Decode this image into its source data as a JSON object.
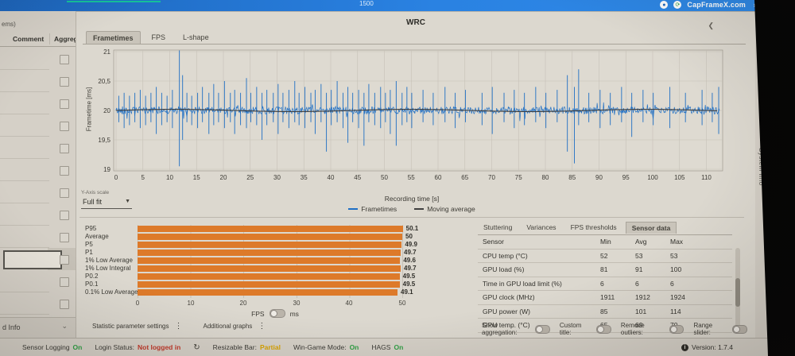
{
  "colors": {
    "accent_blue": "#2a7fe0",
    "bar_orange": "#dd7a2a",
    "line_blue": "#1f6fc4",
    "avg_dark": "#3f3f3f",
    "green": "#2f9e44",
    "red": "#c0392b",
    "amber": "#d7a200"
  },
  "topbar": {
    "brand": "CapFrameX.com",
    "center_text": "1500"
  },
  "sidebar": {
    "top_cut_text": "ems)",
    "columns": [
      "Comment",
      "Aggreg"
    ],
    "row_count": 12,
    "input_row_index": 9,
    "comment_input_value": "",
    "footer_label": "d Info"
  },
  "main": {
    "title": "WRC",
    "tabs": [
      {
        "label": "Frametimes",
        "active": true
      },
      {
        "label": "FPS",
        "active": false
      },
      {
        "label": "L-shape",
        "active": false
      }
    ],
    "yaxis_scale_label": "Y-Axis scale",
    "yaxis_scale_value": "Full fit",
    "fps_toggle": {
      "left": "FPS",
      "right": "ms"
    },
    "side_tab": "System Info"
  },
  "chart_data": [
    {
      "type": "line",
      "title": "WRC",
      "xlabel": "Recording time [s]",
      "ylabel": "Frametime [ms]",
      "xlim": [
        0,
        113
      ],
      "ylim": [
        19,
        21
      ],
      "xticks": [
        0,
        5,
        10,
        15,
        20,
        25,
        30,
        35,
        40,
        45,
        50,
        55,
        60,
        65,
        70,
        75,
        80,
        85,
        90,
        95,
        100,
        105,
        110
      ],
      "yticks": [
        19,
        19.5,
        20,
        20.5,
        21
      ],
      "ytick_labels": [
        "19",
        "19,5",
        "20",
        "20,5",
        "21"
      ],
      "grid": true,
      "legend_position": "bottom",
      "series": [
        {
          "name": "Frametimes",
          "color": "#1f6fc4",
          "baseline": 20.0,
          "noise_amplitude": 0.06,
          "spikes": [
            [
              0.5,
              19.8,
              20.25
            ],
            [
              1.5,
              19.7,
              20.3
            ],
            [
              2.5,
              19.75,
              20.25
            ],
            [
              3.5,
              19.8,
              20.3
            ],
            [
              4.5,
              19.7,
              20.35
            ],
            [
              5.5,
              19.75,
              20.25
            ],
            [
              6.5,
              19.8,
              20.3
            ],
            [
              7.5,
              19.6,
              20.4
            ],
            [
              8.5,
              19.75,
              20.3
            ],
            [
              9.5,
              19.8,
              20.25
            ],
            [
              10.5,
              19.7,
              20.35
            ],
            [
              11.8,
              19.05,
              21.02
            ],
            [
              12.4,
              19.5,
              20.6
            ],
            [
              13.2,
              19.8,
              20.3
            ],
            [
              14.1,
              19.75,
              20.25
            ],
            [
              15.2,
              19.7,
              20.3
            ],
            [
              16.1,
              19.8,
              20.4
            ],
            [
              17.3,
              19.6,
              20.3
            ],
            [
              18.2,
              19.75,
              20.45
            ],
            [
              19.1,
              19.8,
              20.3
            ],
            [
              20.2,
              19.7,
              20.5
            ],
            [
              21.3,
              19.8,
              20.3
            ],
            [
              22.1,
              19.6,
              20.35
            ],
            [
              23.2,
              19.75,
              20.3
            ],
            [
              24.3,
              19.7,
              20.55
            ],
            [
              25.1,
              19.8,
              20.3
            ],
            [
              26.2,
              19.75,
              20.4
            ],
            [
              27.2,
              19.5,
              20.3
            ],
            [
              28.1,
              19.75,
              20.35
            ],
            [
              29.3,
              19.8,
              20.3
            ],
            [
              30.2,
              19.6,
              20.45
            ],
            [
              31.1,
              19.8,
              20.3
            ],
            [
              32.2,
              19.7,
              20.35
            ],
            [
              33.3,
              19.8,
              20.5
            ],
            [
              34.1,
              19.75,
              20.3
            ],
            [
              35.2,
              19.7,
              20.4
            ],
            [
              36.3,
              19.8,
              20.3
            ],
            [
              37.1,
              19.6,
              20.35
            ],
            [
              38.2,
              19.8,
              20.45
            ],
            [
              39.2,
              19.3,
              20.3
            ],
            [
              40.1,
              19.75,
              20.35
            ],
            [
              41.2,
              19.8,
              20.5
            ],
            [
              42.3,
              19.7,
              20.3
            ],
            [
              43.2,
              19.45,
              20.4
            ],
            [
              44.1,
              19.8,
              20.3
            ],
            [
              45.2,
              19.7,
              20.35
            ],
            [
              46.2,
              19.4,
              20.3
            ],
            [
              47.1,
              19.8,
              20.45
            ],
            [
              48.2,
              19.75,
              20.3
            ],
            [
              49.3,
              19.7,
              20.4
            ],
            [
              50.2,
              19.8,
              20.3
            ],
            [
              51.1,
              19.6,
              20.35
            ],
            [
              52.2,
              19.4,
              20.5
            ],
            [
              53.3,
              19.75,
              20.3
            ],
            [
              54.2,
              19.8,
              20.4
            ],
            [
              55.1,
              19.7,
              20.3
            ],
            [
              57.2,
              19.8,
              20.35
            ],
            [
              59.1,
              19.75,
              20.3
            ],
            [
              61.3,
              19.8,
              20.4
            ],
            [
              63.2,
              19.7,
              20.3
            ],
            [
              65.1,
              19.8,
              20.35
            ],
            [
              68.2,
              19.75,
              20.3
            ],
            [
              70.1,
              19.6,
              20.4
            ],
            [
              72.3,
              19.8,
              20.3
            ],
            [
              74.2,
              19.7,
              20.35
            ],
            [
              76.1,
              19.75,
              20.3
            ],
            [
              78.2,
              19.8,
              20.4
            ],
            [
              80.1,
              19.7,
              20.3
            ],
            [
              82.2,
              19.8,
              20.35
            ],
            [
              84.1,
              19.3,
              20.6
            ],
            [
              85.4,
              19.1,
              20.4
            ],
            [
              86.2,
              19.75,
              20.7
            ],
            [
              88.1,
              19.8,
              20.3
            ],
            [
              90.2,
              19.7,
              20.35
            ],
            [
              92.1,
              19.75,
              20.3
            ],
            [
              94.2,
              19.8,
              20.4
            ],
            [
              96.1,
              19.55,
              20.3
            ],
            [
              98.2,
              19.8,
              20.35
            ],
            [
              100.1,
              19.75,
              20.3
            ],
            [
              103.2,
              19.7,
              20.4
            ],
            [
              106.1,
              19.8,
              20.3
            ],
            [
              109.2,
              19.75,
              20.35
            ],
            [
              111.1,
              19.8,
              20.3
            ],
            [
              112.3,
              19.6,
              20.4
            ]
          ]
        },
        {
          "name": "Moving average",
          "color": "#3f3f3f",
          "baseline": 20.0
        }
      ]
    },
    {
      "type": "bar",
      "orientation": "horizontal",
      "categories": [
        "P95",
        "Average",
        "P5",
        "P1",
        "1% Low Average",
        "1% Low Integral",
        "P0.2",
        "P0.1",
        "0.1% Low Average"
      ],
      "values": [
        50.1,
        50,
        49.9,
        49.7,
        49.6,
        49.7,
        49.5,
        49.5,
        49.1
      ],
      "value_labels": [
        "50.1",
        "50",
        "49.9",
        "49.7",
        "49.6",
        "49.7",
        "49.5",
        "49.5",
        "49.1"
      ],
      "xticks": [
        0,
        10,
        20,
        30,
        40,
        50
      ],
      "xlim": [
        0,
        52
      ],
      "xlabel": "FPS",
      "bar_color": "#dd7a2a"
    }
  ],
  "sensor_panel": {
    "tabs": [
      {
        "label": "Stuttering",
        "active": false
      },
      {
        "label": "Variances",
        "active": false
      },
      {
        "label": "FPS thresholds",
        "active": false
      },
      {
        "label": "Sensor data",
        "active": true
      }
    ],
    "columns": [
      "Sensor",
      "Min",
      "Avg",
      "Max"
    ],
    "rows": [
      [
        "CPU temp (°C)",
        "52",
        "53",
        "53"
      ],
      [
        "GPU load (%)",
        "81",
        "91",
        "100"
      ],
      [
        "Time in GPU load limit (%)",
        "6",
        "6",
        "6"
      ],
      [
        "GPU clock (MHz)",
        "1911",
        "1912",
        "1924"
      ],
      [
        "GPU power (W)",
        "85",
        "101",
        "114"
      ],
      [
        "GPU temp. (°C)",
        "65",
        "69",
        "70"
      ]
    ]
  },
  "footer_controls": {
    "menus": [
      {
        "label": "Statistic parameter settings"
      },
      {
        "label": "Additional graphs"
      }
    ],
    "toggles": [
      {
        "label": "Show aggregation:",
        "on": false
      },
      {
        "label": "Custom title:",
        "on": false
      },
      {
        "label": "Remove outliers:",
        "on": false
      },
      {
        "label": "Range slider:",
        "on": false
      }
    ]
  },
  "statusbar": {
    "items": [
      {
        "label": "Sensor Logging",
        "value": "On",
        "value_color": "green"
      },
      {
        "label": "Login Status:",
        "value": "Not logged in",
        "value_color": "red"
      },
      {
        "icon": "refresh"
      },
      {
        "label": "Resizable Bar:",
        "value": "Partial",
        "value_color": "amber"
      },
      {
        "label": "Win-Game Mode:",
        "value": "On",
        "value_color": "green"
      },
      {
        "label": "HAGS",
        "value": "On",
        "value_color": "green"
      }
    ],
    "version": "Version: 1.7.4"
  }
}
